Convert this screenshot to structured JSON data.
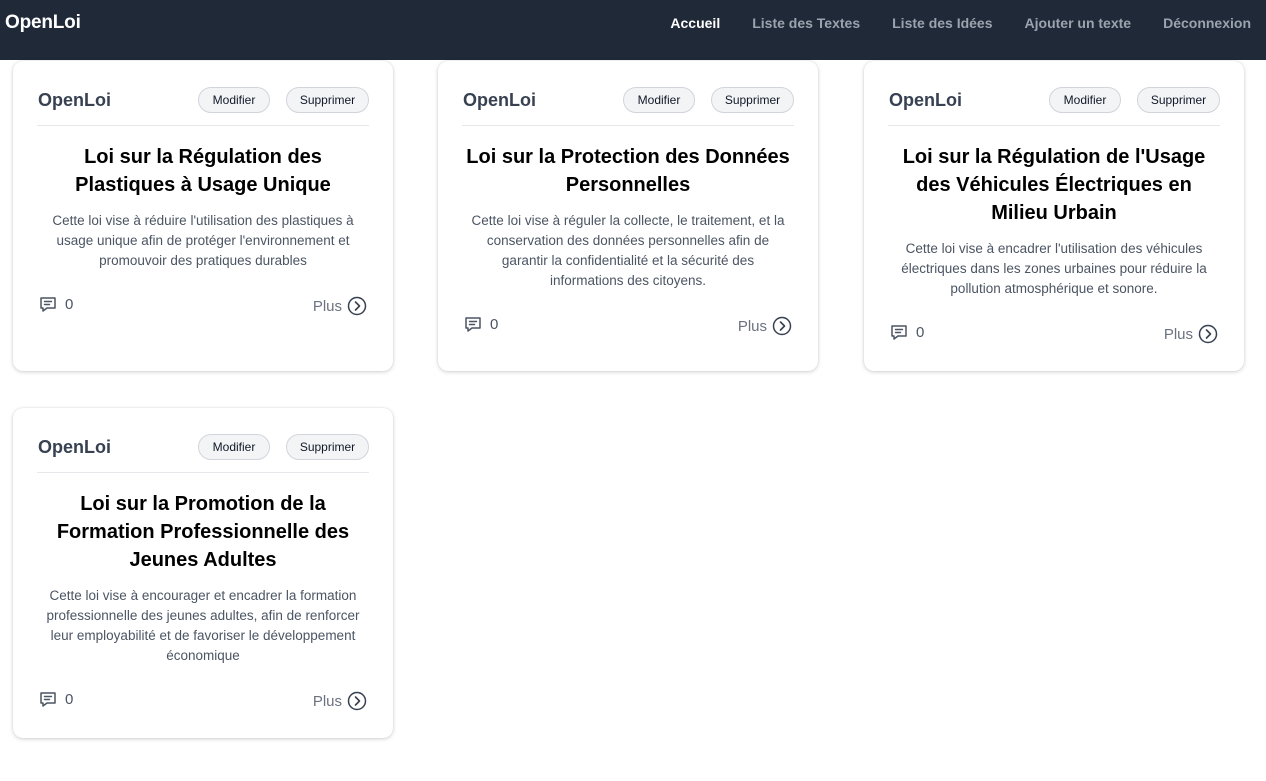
{
  "nav": {
    "brand": "OpenLoi",
    "links": [
      "Accueil",
      "Liste des Textes",
      "Liste des Idées",
      "Ajouter un texte",
      "Déconnexion"
    ]
  },
  "cards": [
    {
      "brand": "OpenLoi",
      "edit_label": "Modifier",
      "delete_label": "Supprimer",
      "title": "Loi sur la Régulation des Plastiques à Usage Unique",
      "description": "Cette loi vise à réduire l'utilisation des plastiques à usage unique afin de protéger l'environnement et promouvoir des pratiques durables",
      "comments": "0",
      "more_label": "Plus"
    },
    {
      "brand": "OpenLoi",
      "edit_label": "Modifier",
      "delete_label": "Supprimer",
      "title": "Loi sur la Protection des Données Personnelles",
      "description": "Cette loi vise à réguler la collecte, le traitement, et la conservation des données personnelles afin de garantir la confidentialité et la sécurité des informations des citoyens.",
      "comments": "0",
      "more_label": "Plus"
    },
    {
      "brand": "OpenLoi",
      "edit_label": "Modifier",
      "delete_label": "Supprimer",
      "title": "Loi sur la Régulation de l'Usage des Véhicules Électriques en Milieu Urbain",
      "description": "Cette loi vise à encadrer l'utilisation des véhicules électriques dans les zones urbaines pour réduire la pollution atmosphérique et sonore.",
      "comments": "0",
      "more_label": "Plus"
    },
    {
      "brand": "OpenLoi",
      "edit_label": "Modifier",
      "delete_label": "Supprimer",
      "title": "Loi sur la Promotion de la Formation Professionnelle des Jeunes Adultes",
      "description": "Cette loi vise à encourager et encadrer la formation professionnelle des jeunes adultes, afin de renforcer leur employabilité et de favoriser le développement économique",
      "comments": "0",
      "more_label": "Plus"
    }
  ]
}
